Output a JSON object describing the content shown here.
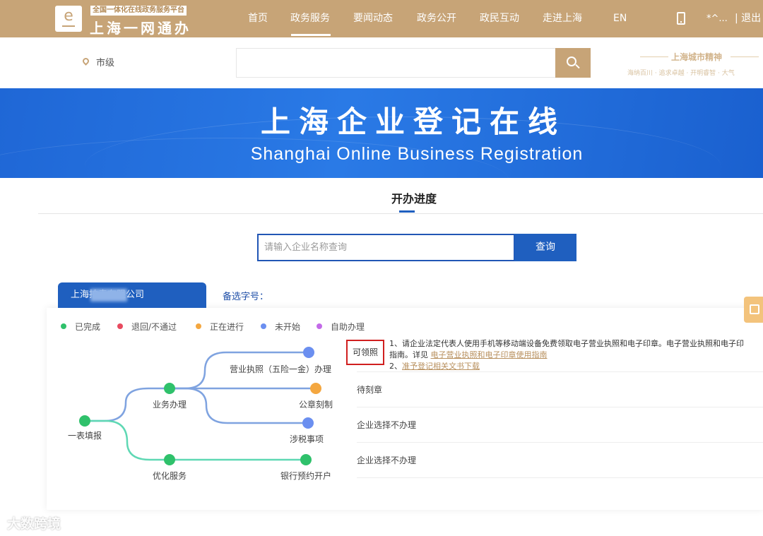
{
  "header": {
    "logo_tagline": "全国一体化在线政务服务平台",
    "logo_title": "上海一网通办",
    "nav": [
      {
        "label": "首页"
      },
      {
        "label": "政务服务"
      },
      {
        "label": "要闻动态"
      },
      {
        "label": "政务公开"
      },
      {
        "label": "政民互动"
      },
      {
        "label": "走进上海"
      },
      {
        "label": "EN"
      }
    ],
    "active_nav": "政务服务",
    "user": "*^...",
    "logout": "退出"
  },
  "search": {
    "location": "市级",
    "placeholder": "",
    "spirit_title": "上海城市精神",
    "spirit_items": "海纳百川 · 追求卓越 · 开明睿智 · 大气"
  },
  "banner": {
    "title": "上海企业登记在线",
    "subtitle": "Shanghai Online Business Registration"
  },
  "progress": {
    "section_title": "开办进度",
    "query_placeholder": "请输入企业名称查询",
    "query_button": "查询",
    "company_tab": "上海拍卖有限公司",
    "alt_name_label": "备选字号：",
    "legend": [
      {
        "label": "已完成",
        "color": "#2fc16b"
      },
      {
        "label": "退回/不通过",
        "color": "#e84a5f"
      },
      {
        "label": "正在进行",
        "color": "#f4a740"
      },
      {
        "label": "未开始",
        "color": "#6b8ff0"
      },
      {
        "label": "自助办理",
        "color": "#c36ae8"
      }
    ],
    "nodes": {
      "root": "一表填报",
      "business": "业务办理",
      "optimize": "优化服务",
      "license": "营业执照（五险一金）办理",
      "seal": "公章刻制",
      "tax": "涉税事项",
      "bank": "银行预约开户"
    },
    "license_status": "可领照",
    "license_detail_line1": "1、请企业法定代表人使用手机等移动端设备免费领取电子营业执照和电子印章。电子营业执照和电子印",
    "license_detail_line2_prefix": "指南。详见",
    "license_detail_link1": "电子营业执照和电子印章使用指南",
    "license_detail_line3_prefix": "2、",
    "license_detail_link2": "准予登记相关文书下载",
    "seal_status": "待刻章",
    "tax_status": "企业选择不办理",
    "bank_status": "企业选择不办理"
  },
  "watermark": "大数跨境"
}
